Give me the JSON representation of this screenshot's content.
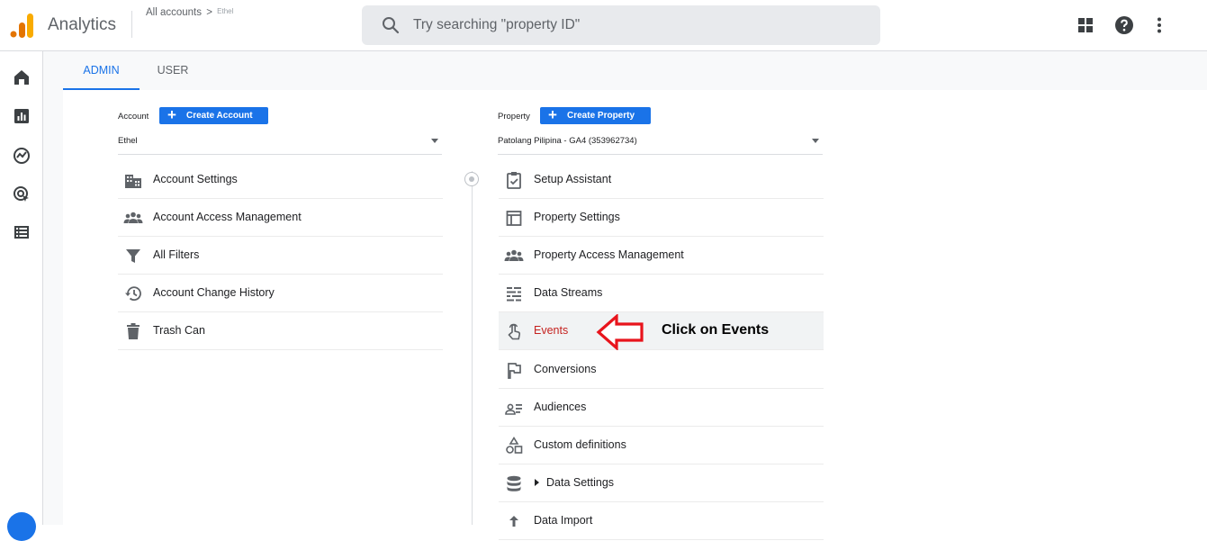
{
  "header": {
    "app_title": "Analytics",
    "breadcrumb_accounts": "All accounts",
    "breadcrumb_sep": ">",
    "breadcrumb_account": "Ethel",
    "search_placeholder": "Try searching \"property ID\""
  },
  "top_icons": [
    "apps-grid-icon",
    "help-icon",
    "more-vert-icon"
  ],
  "left_nav": [
    "home-icon",
    "reports-icon",
    "explore-icon",
    "advertising-icon",
    "configure-icon"
  ],
  "tabs": [
    {
      "label": "ADMIN",
      "active": true
    },
    {
      "label": "USER",
      "active": false
    }
  ],
  "account": {
    "label": "Account",
    "create_label": "Create Account",
    "selected": "Ethel",
    "items": [
      {
        "label": "Account Settings",
        "icon": "building-icon"
      },
      {
        "label": "Account Access Management",
        "icon": "people-icon"
      },
      {
        "label": "All Filters",
        "icon": "filter-icon"
      },
      {
        "label": "Account Change History",
        "icon": "history-icon"
      },
      {
        "label": "Trash Can",
        "icon": "trash-icon"
      }
    ]
  },
  "property": {
    "label": "Property",
    "create_label": "Create Property",
    "selected": "Patolang Pilipina - GA4 (353962734)",
    "items": [
      {
        "label": "Setup Assistant",
        "icon": "checklist-icon"
      },
      {
        "label": "Property Settings",
        "icon": "layout-icon"
      },
      {
        "label": "Property Access Management",
        "icon": "people-icon"
      },
      {
        "label": "Data Streams",
        "icon": "streams-icon"
      },
      {
        "label": "Events",
        "icon": "touch-icon",
        "highlighted": true
      },
      {
        "label": "Conversions",
        "icon": "flag-icon"
      },
      {
        "label": "Audiences",
        "icon": "audiences-icon"
      },
      {
        "label": "Custom definitions",
        "icon": "shapes-icon"
      },
      {
        "label": "Data Settings",
        "icon": "database-icon"
      },
      {
        "label": "Data Import",
        "icon": "upload-icon"
      }
    ]
  },
  "annotation": {
    "text": "Click on Events",
    "arrow_color": "#e8141c"
  },
  "colors": {
    "accent": "#1a73e8",
    "highlight_text": "#c5221f",
    "logo_orange": "#f9ab00",
    "logo_dark_orange": "#e37400"
  }
}
